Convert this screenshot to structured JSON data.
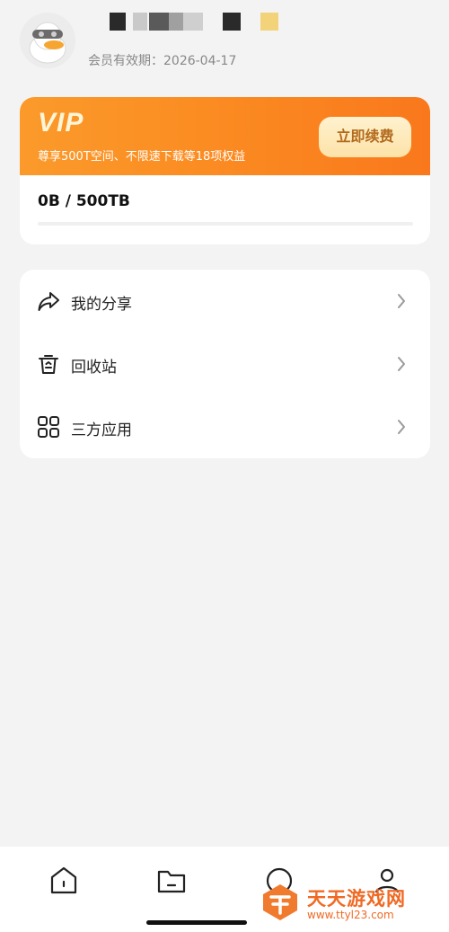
{
  "header": {
    "expiry_label": "会员有效期：2026-04-17",
    "mosaic_colors": [
      "#2a2a2a",
      "#c9c9c9",
      "#5a5a5a",
      "#a0a0a0",
      "#cfcfcf",
      "#2a2a2a",
      "#f3d37a"
    ]
  },
  "vip": {
    "title": "VIP",
    "description": "尊享500T空间、不限速下载等18项权益",
    "renew_label": "立即续费",
    "storage_label": "0B / 500TB",
    "storage_used_fraction": 0,
    "accent_color": "#fb8c22"
  },
  "menu": {
    "items": [
      {
        "label": "我的分享",
        "icon": "share-icon"
      },
      {
        "label": "回收站",
        "icon": "trash-icon"
      },
      {
        "label": "三方应用",
        "icon": "apps-grid-icon"
      }
    ]
  },
  "bottom_nav": {
    "items": [
      {
        "icon": "home-icon"
      },
      {
        "icon": "folder-icon"
      },
      {
        "icon": "nav-icon"
      },
      {
        "icon": "profile-icon"
      }
    ]
  },
  "watermark": {
    "title": "天天游戏网",
    "url": "www.ttyl23.com"
  }
}
